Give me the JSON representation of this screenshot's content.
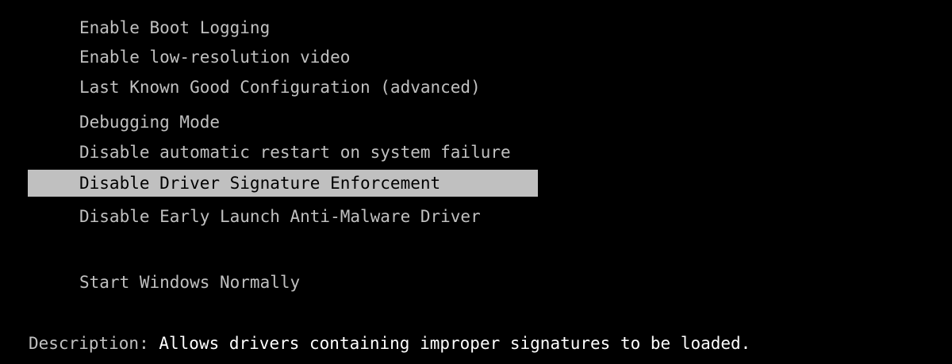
{
  "menu": {
    "items": [
      {
        "label": "Enable Boot Logging",
        "selected": false
      },
      {
        "label": "Enable low-resolution video",
        "selected": false
      },
      {
        "label": "Last Known Good Configuration (advanced)",
        "selected": false
      },
      {
        "label": "Debugging Mode",
        "selected": false
      },
      {
        "label": "Disable automatic restart on system failure",
        "selected": false
      },
      {
        "label": "Disable Driver Signature Enforcement",
        "selected": true
      },
      {
        "label": "Disable Early Launch Anti-Malware Driver",
        "selected": false
      },
      {
        "label": "Start Windows Normally",
        "selected": false
      }
    ]
  },
  "description": {
    "label": "Description: ",
    "text": "Allows drivers containing improper signatures to be loaded."
  },
  "colors": {
    "background": "#000000",
    "text": "#c0c0c0",
    "highlight_bg": "#c0c0c0",
    "highlight_text": "#000000",
    "description_text": "#ffffff"
  }
}
